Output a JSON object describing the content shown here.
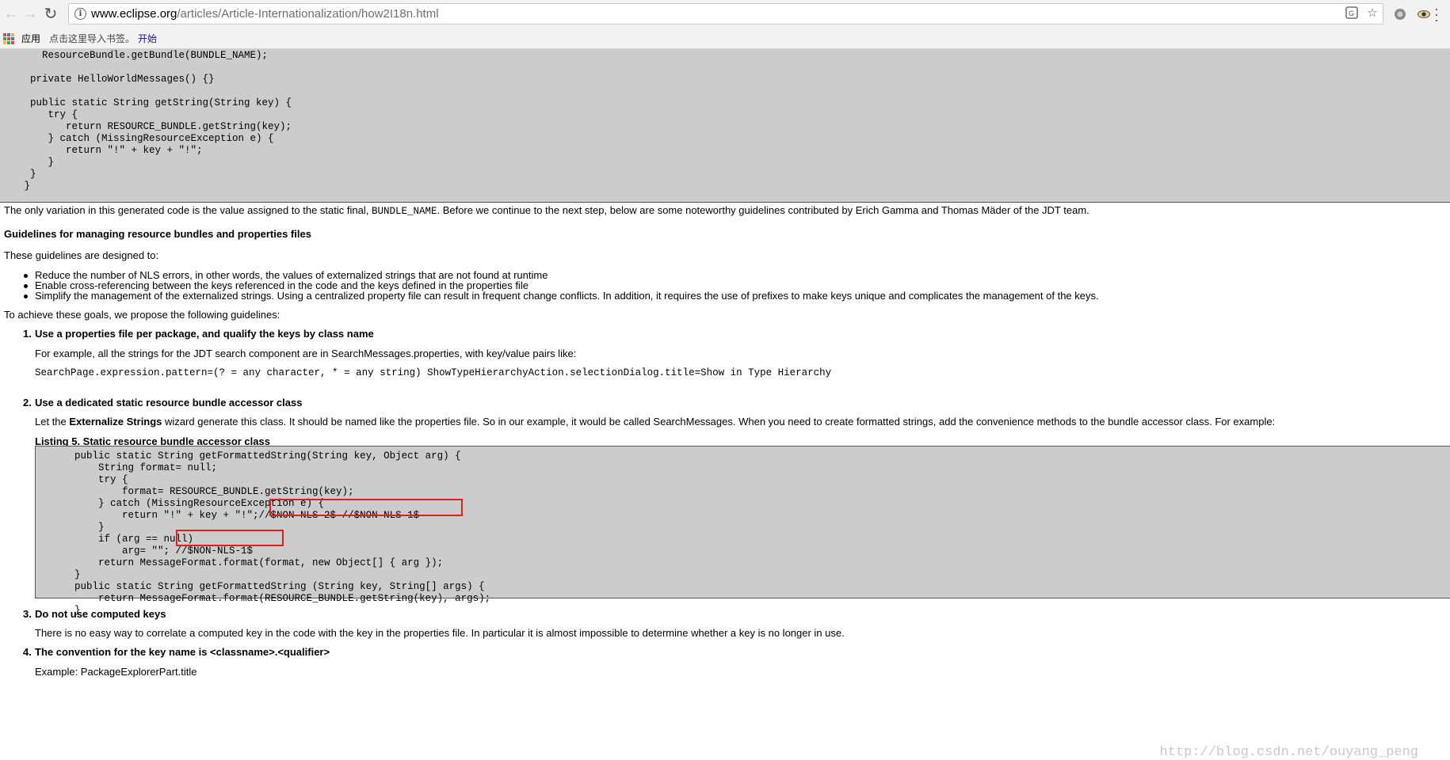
{
  "browser": {
    "url_host": "www.eclipse.org",
    "url_path": "/articles/Article-Internationalization/how2I18n.html",
    "bookmarks": {
      "apps_label": "应用",
      "import_prompt": "点击这里导入书签。",
      "start_link": "开始"
    },
    "icons": [
      "back-icon",
      "forward-icon",
      "reload-icon",
      "info-icon",
      "translate-icon",
      "star-icon",
      "extension-icon",
      "eye-icon",
      "menu-icon"
    ]
  },
  "page": {
    "top_code": "    ResourceBundle.getBundle(BUNDLE_NAME);\n\n  private HelloWorldMessages() {}\n\n  public static String getString(String key) {\n     try {\n        return RESOURCE_BUNDLE.getString(key);\n     } catch (MissingResourceException e) {\n        return \"!\" + key + \"!\";\n     }\n  }\n }",
    "variation_text_1": "The only variation in this generated code is the value assigned to the static final, ",
    "variation_code": "BUNDLE_NAME",
    "variation_text_2": ". Before we continue to the next step, below are some noteworthy guidelines contributed by Erich Gamma and Thomas Mäder of the JDT team.",
    "guidelines_heading": "Guidelines for managing resource bundles and properties files",
    "designed_intro": "These guidelines are designed to:",
    "goals": [
      "Reduce the number of NLS errors, in other words, the values of externalized strings that are not found at runtime",
      "Enable cross-referencing between the keys referenced in the code and the keys defined in the properties file",
      "Simplify the management of the externalized strings. Using a centralized property file can result in frequent change conflicts. In addition, it requires the use of prefixes to make keys unique and complicates the management of the keys."
    ],
    "achieve_text": "To achieve these goals, we propose the following guidelines:",
    "item1": {
      "number": "1.",
      "title": "Use a properties file per package, and qualify the keys by class name",
      "example_text": "For example, all the strings for the JDT search component are in SearchMessages.properties, with key/value pairs like:",
      "code": "SearchPage.expression.pattern=(? = any character, * = any string)\nShowTypeHierarchyAction.selectionDialog.title=Show in Type Hierarchy"
    },
    "item2": {
      "number": "2.",
      "title": "Use a dedicated static resource bundle accessor class",
      "text_1": "Let the ",
      "text_bold": "Externalize Strings",
      "text_2": " wizard generate this class. It should be named like the properties file. So in our example, it would be called SearchMessages. When you need to create formatted strings, add the convenience methods to the bundle accessor class. For example:",
      "listing_title": "Listing 5. Static resource bundle accessor class",
      "code": "      public static String getFormattedString(String key, Object arg) {\n          String format= null;\n          try {\n              format= RESOURCE_BUNDLE.getString(key);\n          } catch (MissingResourceException e) {\n              return \"!\" + key + \"!\";//$NON-NLS-2$ //$NON-NLS-1$\n          }\n          if (arg == null)\n              arg= \"\"; //$NON-NLS-1$\n          return MessageFormat.format(format, new Object[] { arg });\n      }\n      public static String getFormattedString (String key, String[] args) {\n          return MessageFormat.format(RESOURCE_BUNDLE.getString(key), args);\n      }"
    },
    "item3": {
      "number": "3.",
      "title": "Do not use computed keys",
      "text": "There is no easy way to correlate a computed key in the code with the key in the properties file. In particular it is almost impossible to determine whether a key is no longer in use."
    },
    "item4": {
      "number": "4.",
      "title": "The convention for the key name is <classname>.<qualifier>",
      "text": "Example: PackageExplorerPart.title"
    }
  },
  "watermark": "http://blog.csdn.net/ouyang_peng",
  "colors": {
    "code_bg": "#cccccc",
    "highlight_box": "#e02020",
    "link": "#1a0dab"
  }
}
